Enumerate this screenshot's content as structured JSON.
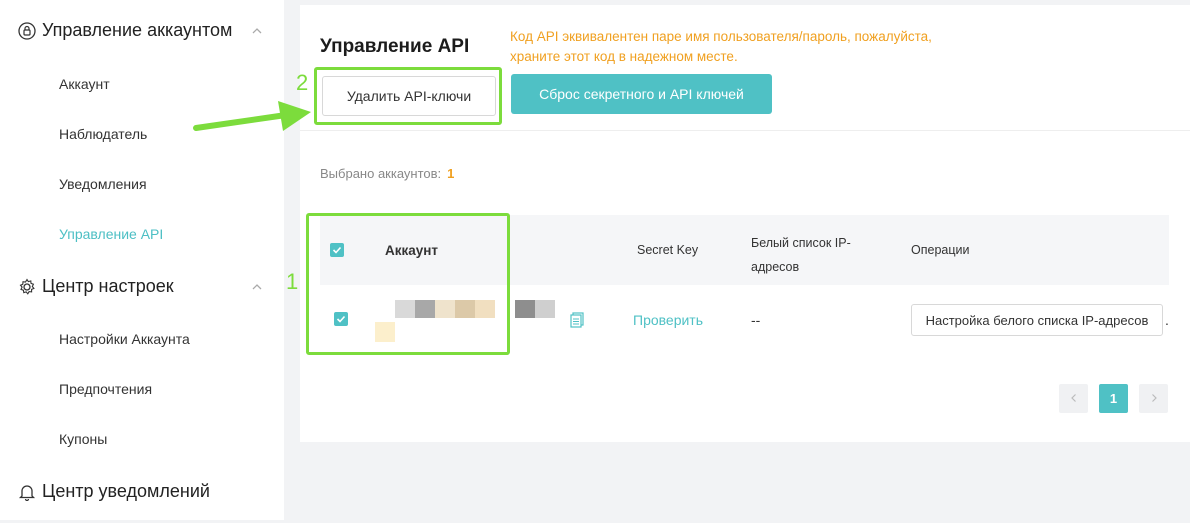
{
  "sidebar": {
    "account_section": "Управление аккаунтом",
    "account_items": [
      "Аккаунт",
      "Наблюдатель",
      "Уведомления",
      "Управление API"
    ],
    "settings_section": "Центр настроек",
    "settings_items": [
      "Настройки Аккаунта",
      "Предпочтения",
      "Купоны"
    ],
    "notifications_section": "Центр уведомлений"
  },
  "main": {
    "title": "Управление API",
    "notice": "Код API эквивалентен паре имя пользователя/пароль, пожалуйста, храните этот код в надежном месте.",
    "delete_button": "Удалить API-ключи",
    "reset_button": "Сброс секретного и API ключей",
    "selected_label": "Выбрано аккаунтов:",
    "selected_count": "1",
    "table": {
      "columns": [
        "Аккаунт",
        "Secret Key",
        "Белый список IP-адресов",
        "Операции"
      ],
      "row": {
        "secret_key_link": "Проверить",
        "ip_whitelist": "--",
        "operation_button": "Настройка белого списка IP-адресов",
        "overflow": "."
      }
    },
    "pagination": {
      "current_page": "1"
    }
  },
  "annotations": {
    "label_1": "1",
    "label_2": "2"
  },
  "colors": {
    "accent": "#4fc1c5",
    "warning": "#f0a020",
    "highlight": "#7cdc3c"
  }
}
